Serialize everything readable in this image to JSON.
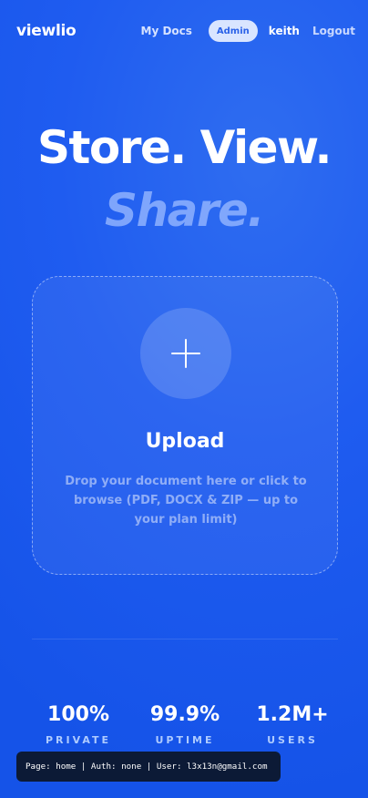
{
  "nav": {
    "logo": "viewlio",
    "my_docs": "My Docs",
    "admin": "Admin",
    "user": "keith",
    "logout": "Logout"
  },
  "hero": {
    "line1": "Store. View.",
    "line2": "Share."
  },
  "upload": {
    "title": "Upload",
    "description": "Drop your document here or click to browse (PDF, DOCX & ZIP — up to your plan limit)",
    "icon": "plus-icon"
  },
  "stats": [
    {
      "value": "100%",
      "label": "PRIVATE"
    },
    {
      "value": "99.9%",
      "label": "UPTIME"
    },
    {
      "value": "1.2M+",
      "label": "USERS"
    }
  ],
  "debug": "Page: home | Auth: none | User: l3x13n@gmail.com",
  "colors": {
    "background": "#1f5cf0",
    "admin_pill_bg": "#d9e5ff",
    "admin_pill_text": "#2b62e8",
    "debug_bg": "#0c1a36"
  }
}
